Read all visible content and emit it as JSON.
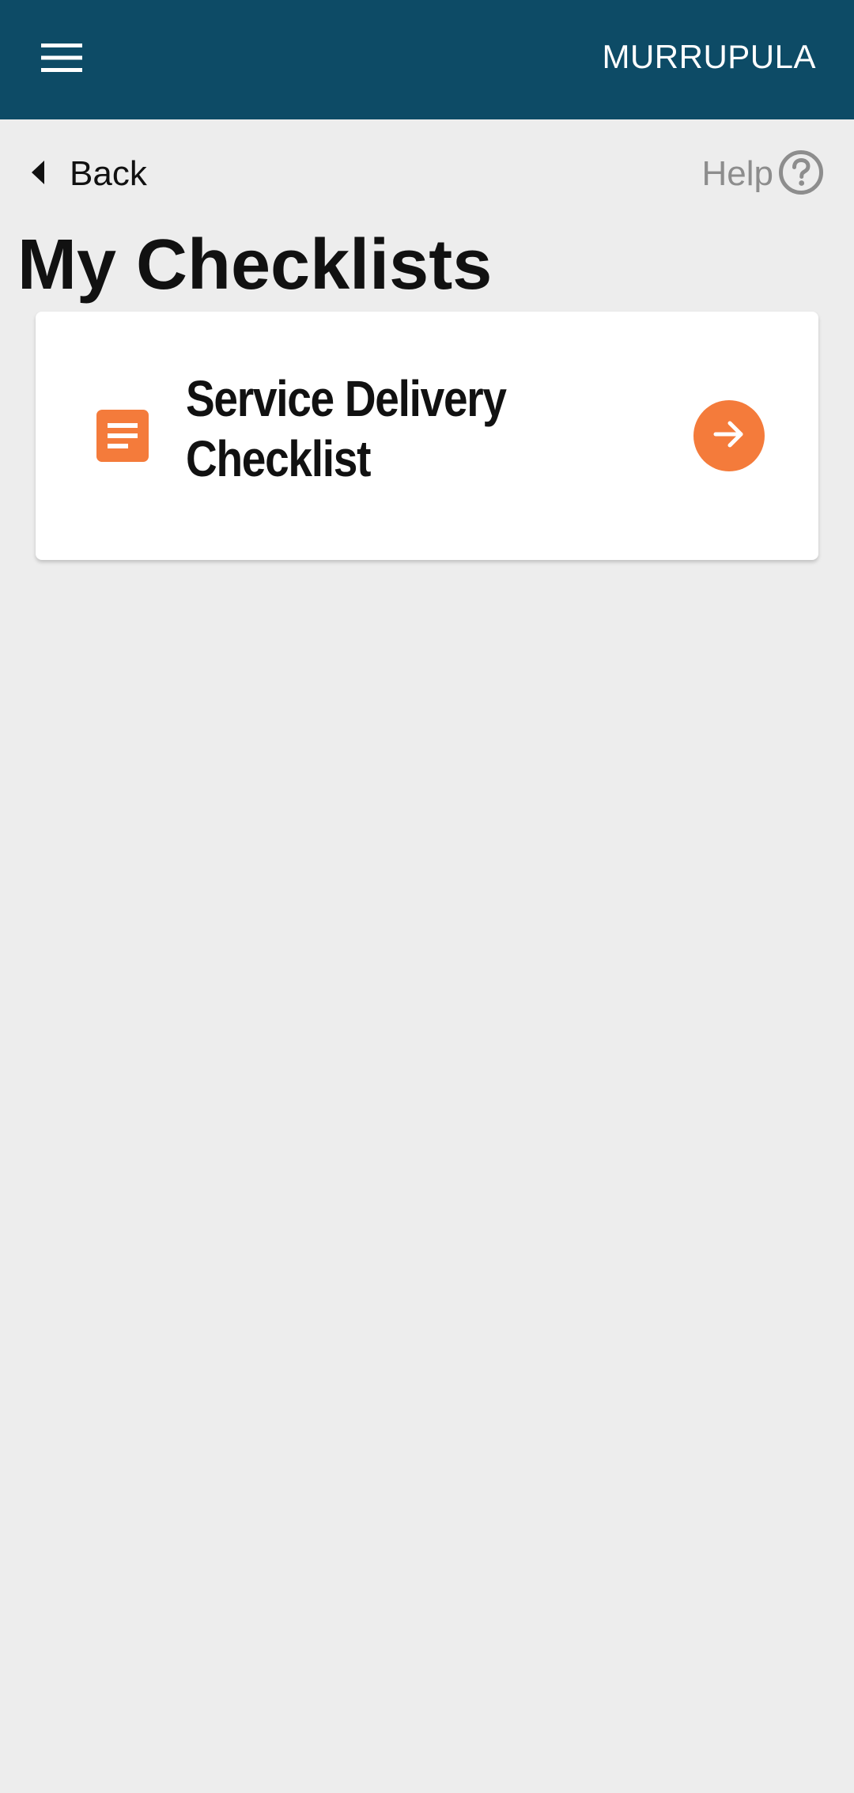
{
  "app_bar": {
    "title": "MURRUPULA",
    "menu_icon": "hamburger-menu-icon",
    "background": "#0d4b66"
  },
  "nav": {
    "back_label": "Back",
    "back_icon": "caret-left-icon",
    "help_label": "Help",
    "help_icon": "question-circle-icon"
  },
  "page": {
    "title": "My Checklists"
  },
  "checklists": [
    {
      "title": "Service Delivery Checklist",
      "icon": "document-icon",
      "action_icon": "arrow-right-circle-icon"
    }
  ],
  "colors": {
    "accent": "#f47b3b",
    "background": "#ededed",
    "card": "#ffffff"
  }
}
